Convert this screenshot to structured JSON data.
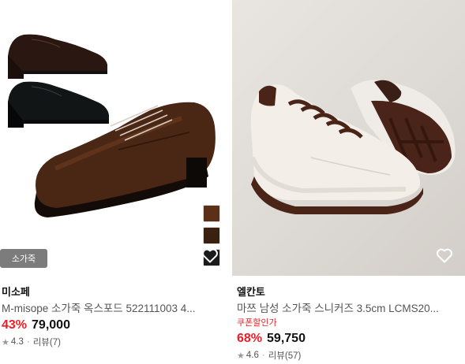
{
  "products": [
    {
      "badge": "소가죽",
      "brand": "미소페",
      "title": "M-misope 소가죽 옥스포드 522111003 4...",
      "discount": "43%",
      "price": "79,000",
      "rating": "4.3",
      "review_label": "리뷰(7)",
      "swatch_colors": [
        "#5b3016",
        "#3a200e",
        "#1b1b1b"
      ]
    },
    {
      "brand": "엘칸토",
      "title": "마쯔 남성 소가죽 스니커즈 3.5cm LCMS20...",
      "coupon": "쿠폰할인가",
      "discount": "68%",
      "price": "59,750",
      "rating": "4.6",
      "review_label": "리뷰(57)"
    }
  ],
  "icons": {
    "star": "star-icon",
    "wishlist": "heart-outline-icon"
  },
  "colors": {
    "discount": "#ee1c25",
    "badge_bg": "#7c7c7c"
  }
}
